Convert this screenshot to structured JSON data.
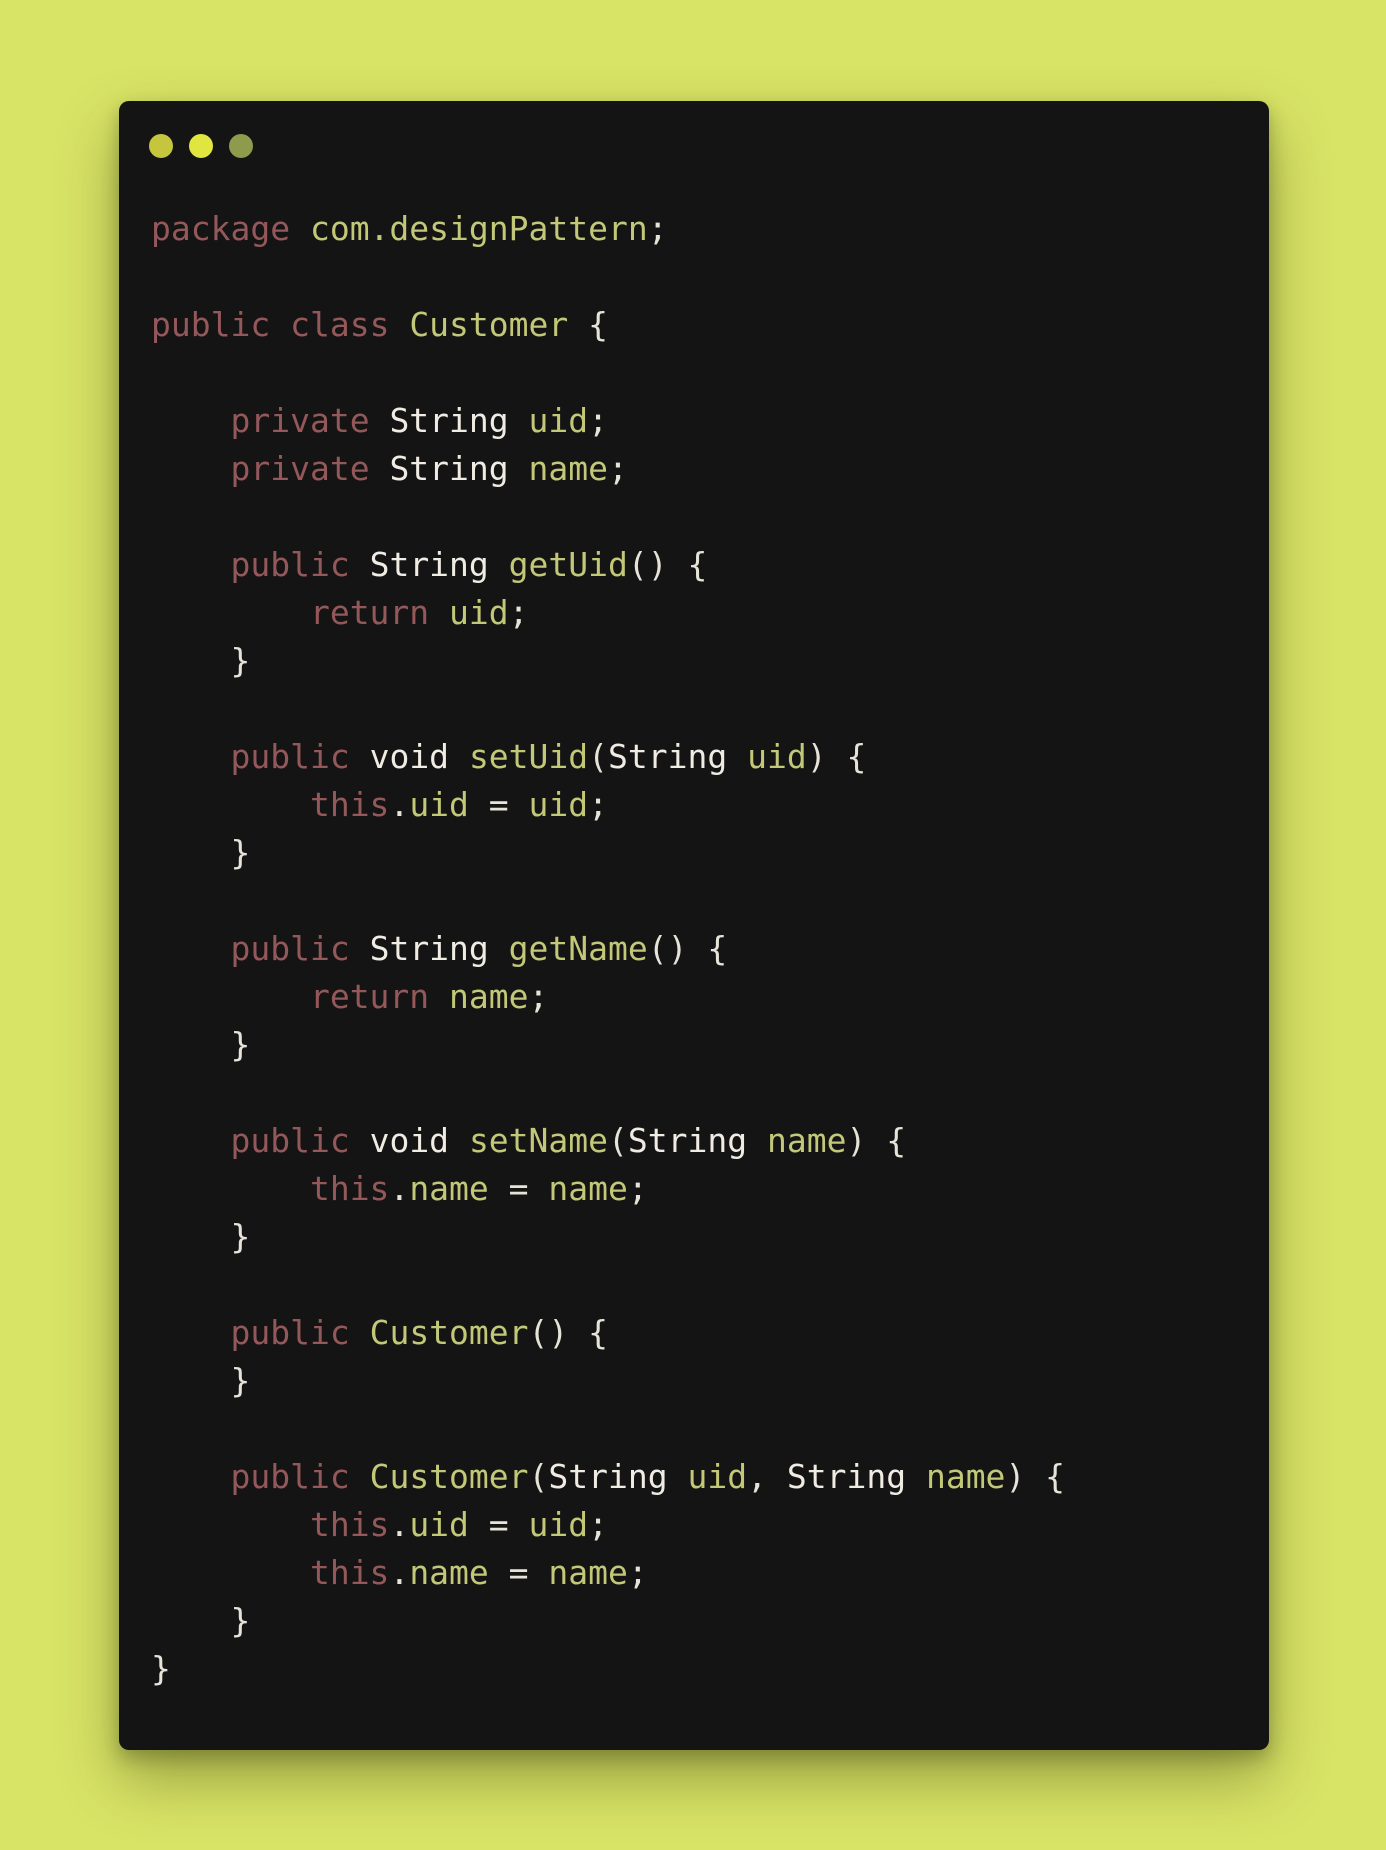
{
  "window": {
    "controls": [
      {
        "name": "close",
        "color": "#c5c53e"
      },
      {
        "name": "minimize",
        "color": "#e0e540"
      },
      {
        "name": "maximize",
        "color": "#8e9a4c"
      }
    ]
  },
  "colors": {
    "background": "#d8e466",
    "editor": "#141414",
    "keyword": "#94585a",
    "type": "#f0ece4",
    "identifier": "#c2c878",
    "punctuation": "#e6e3d8"
  },
  "code": {
    "language": "java",
    "lines": [
      [
        {
          "t": "kw",
          "v": "package"
        },
        {
          "t": "plain",
          "v": " "
        },
        {
          "t": "ident",
          "v": "com.designPattern"
        },
        {
          "t": "punct",
          "v": ";"
        }
      ],
      [],
      [
        {
          "t": "kw",
          "v": "public"
        },
        {
          "t": "plain",
          "v": " "
        },
        {
          "t": "kw",
          "v": "class"
        },
        {
          "t": "plain",
          "v": " "
        },
        {
          "t": "ident",
          "v": "Customer"
        },
        {
          "t": "plain",
          "v": " "
        },
        {
          "t": "punct",
          "v": "{"
        }
      ],
      [],
      [
        {
          "t": "plain",
          "v": "    "
        },
        {
          "t": "kw",
          "v": "private"
        },
        {
          "t": "plain",
          "v": " "
        },
        {
          "t": "type",
          "v": "String"
        },
        {
          "t": "plain",
          "v": " "
        },
        {
          "t": "ident",
          "v": "uid"
        },
        {
          "t": "punct",
          "v": ";"
        }
      ],
      [
        {
          "t": "plain",
          "v": "    "
        },
        {
          "t": "kw",
          "v": "private"
        },
        {
          "t": "plain",
          "v": " "
        },
        {
          "t": "type",
          "v": "String"
        },
        {
          "t": "plain",
          "v": " "
        },
        {
          "t": "ident",
          "v": "name"
        },
        {
          "t": "punct",
          "v": ";"
        }
      ],
      [],
      [
        {
          "t": "plain",
          "v": "    "
        },
        {
          "t": "kw",
          "v": "public"
        },
        {
          "t": "plain",
          "v": " "
        },
        {
          "t": "type",
          "v": "String"
        },
        {
          "t": "plain",
          "v": " "
        },
        {
          "t": "ident",
          "v": "getUid"
        },
        {
          "t": "punct",
          "v": "() {"
        }
      ],
      [
        {
          "t": "plain",
          "v": "        "
        },
        {
          "t": "kw",
          "v": "return"
        },
        {
          "t": "plain",
          "v": " "
        },
        {
          "t": "ident",
          "v": "uid"
        },
        {
          "t": "punct",
          "v": ";"
        }
      ],
      [
        {
          "t": "plain",
          "v": "    "
        },
        {
          "t": "punct",
          "v": "}"
        }
      ],
      [],
      [
        {
          "t": "plain",
          "v": "    "
        },
        {
          "t": "kw",
          "v": "public"
        },
        {
          "t": "plain",
          "v": " "
        },
        {
          "t": "type",
          "v": "void"
        },
        {
          "t": "plain",
          "v": " "
        },
        {
          "t": "ident",
          "v": "setUid"
        },
        {
          "t": "punct",
          "v": "("
        },
        {
          "t": "type",
          "v": "String"
        },
        {
          "t": "plain",
          "v": " "
        },
        {
          "t": "ident",
          "v": "uid"
        },
        {
          "t": "punct",
          "v": ") {"
        }
      ],
      [
        {
          "t": "plain",
          "v": "        "
        },
        {
          "t": "kw",
          "v": "this"
        },
        {
          "t": "punct",
          "v": "."
        },
        {
          "t": "ident",
          "v": "uid"
        },
        {
          "t": "plain",
          "v": " "
        },
        {
          "t": "punct",
          "v": "="
        },
        {
          "t": "plain",
          "v": " "
        },
        {
          "t": "ident",
          "v": "uid"
        },
        {
          "t": "punct",
          "v": ";"
        }
      ],
      [
        {
          "t": "plain",
          "v": "    "
        },
        {
          "t": "punct",
          "v": "}"
        }
      ],
      [],
      [
        {
          "t": "plain",
          "v": "    "
        },
        {
          "t": "kw",
          "v": "public"
        },
        {
          "t": "plain",
          "v": " "
        },
        {
          "t": "type",
          "v": "String"
        },
        {
          "t": "plain",
          "v": " "
        },
        {
          "t": "ident",
          "v": "getName"
        },
        {
          "t": "punct",
          "v": "() {"
        }
      ],
      [
        {
          "t": "plain",
          "v": "        "
        },
        {
          "t": "kw",
          "v": "return"
        },
        {
          "t": "plain",
          "v": " "
        },
        {
          "t": "ident",
          "v": "name"
        },
        {
          "t": "punct",
          "v": ";"
        }
      ],
      [
        {
          "t": "plain",
          "v": "    "
        },
        {
          "t": "punct",
          "v": "}"
        }
      ],
      [],
      [
        {
          "t": "plain",
          "v": "    "
        },
        {
          "t": "kw",
          "v": "public"
        },
        {
          "t": "plain",
          "v": " "
        },
        {
          "t": "type",
          "v": "void"
        },
        {
          "t": "plain",
          "v": " "
        },
        {
          "t": "ident",
          "v": "setName"
        },
        {
          "t": "punct",
          "v": "("
        },
        {
          "t": "type",
          "v": "String"
        },
        {
          "t": "plain",
          "v": " "
        },
        {
          "t": "ident",
          "v": "name"
        },
        {
          "t": "punct",
          "v": ") {"
        }
      ],
      [
        {
          "t": "plain",
          "v": "        "
        },
        {
          "t": "kw",
          "v": "this"
        },
        {
          "t": "punct",
          "v": "."
        },
        {
          "t": "ident",
          "v": "name"
        },
        {
          "t": "plain",
          "v": " "
        },
        {
          "t": "punct",
          "v": "="
        },
        {
          "t": "plain",
          "v": " "
        },
        {
          "t": "ident",
          "v": "name"
        },
        {
          "t": "punct",
          "v": ";"
        }
      ],
      [
        {
          "t": "plain",
          "v": "    "
        },
        {
          "t": "punct",
          "v": "}"
        }
      ],
      [],
      [
        {
          "t": "plain",
          "v": "    "
        },
        {
          "t": "kw",
          "v": "public"
        },
        {
          "t": "plain",
          "v": " "
        },
        {
          "t": "ident",
          "v": "Customer"
        },
        {
          "t": "punct",
          "v": "() {"
        }
      ],
      [
        {
          "t": "plain",
          "v": "    "
        },
        {
          "t": "punct",
          "v": "}"
        }
      ],
      [],
      [
        {
          "t": "plain",
          "v": "    "
        },
        {
          "t": "kw",
          "v": "public"
        },
        {
          "t": "plain",
          "v": " "
        },
        {
          "t": "ident",
          "v": "Customer"
        },
        {
          "t": "punct",
          "v": "("
        },
        {
          "t": "type",
          "v": "String"
        },
        {
          "t": "plain",
          "v": " "
        },
        {
          "t": "ident",
          "v": "uid"
        },
        {
          "t": "punct",
          "v": ", "
        },
        {
          "t": "type",
          "v": "String"
        },
        {
          "t": "plain",
          "v": " "
        },
        {
          "t": "ident",
          "v": "name"
        },
        {
          "t": "punct",
          "v": ") {"
        }
      ],
      [
        {
          "t": "plain",
          "v": "        "
        },
        {
          "t": "kw",
          "v": "this"
        },
        {
          "t": "punct",
          "v": "."
        },
        {
          "t": "ident",
          "v": "uid"
        },
        {
          "t": "plain",
          "v": " "
        },
        {
          "t": "punct",
          "v": "="
        },
        {
          "t": "plain",
          "v": " "
        },
        {
          "t": "ident",
          "v": "uid"
        },
        {
          "t": "punct",
          "v": ";"
        }
      ],
      [
        {
          "t": "plain",
          "v": "        "
        },
        {
          "t": "kw",
          "v": "this"
        },
        {
          "t": "punct",
          "v": "."
        },
        {
          "t": "ident",
          "v": "name"
        },
        {
          "t": "plain",
          "v": " "
        },
        {
          "t": "punct",
          "v": "="
        },
        {
          "t": "plain",
          "v": " "
        },
        {
          "t": "ident",
          "v": "name"
        },
        {
          "t": "punct",
          "v": ";"
        }
      ],
      [
        {
          "t": "plain",
          "v": "    "
        },
        {
          "t": "punct",
          "v": "}"
        }
      ],
      [
        {
          "t": "punct",
          "v": "}"
        }
      ]
    ]
  }
}
